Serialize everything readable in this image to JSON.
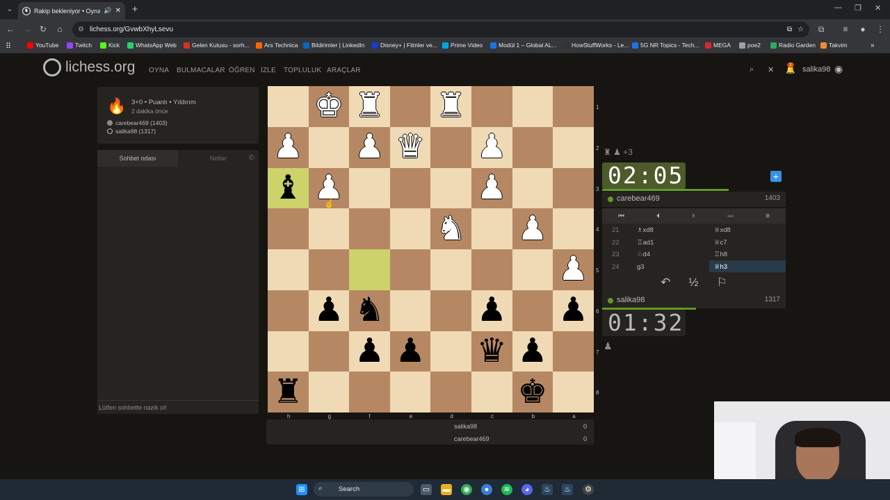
{
  "browser": {
    "tab_title": "Rakip bekleniyor • Oyna ca",
    "url": "lichess.org/GvwbXhyLsevu",
    "bookmarks": [
      "YouTube",
      "Twitch",
      "Kick",
      "WhatsApp Web",
      "Gelen Kutusu - sorh...",
      "Ars Technica",
      "Bildirimler | LinkedIn",
      "Disney+ | Filmler ve...",
      "Prime Video",
      "Modül 1 – Global AL...",
      "HowStuffWorks - Le...",
      "5G NR Topics - Tech...",
      "MEGA",
      "poe2",
      "Radio Garden",
      "Takvim"
    ],
    "bookmark_colors": [
      "#ff0000",
      "#9146ff",
      "#53fc18",
      "#25d366",
      "#d93025",
      "#ff6600",
      "#0a66c2",
      "#113ccf",
      "#00a8e1",
      "#1a73e8",
      "#333333",
      "#1a73e8",
      "#d9272e",
      "#9aa0a6",
      "#27ae60",
      "#f28b30"
    ]
  },
  "site": {
    "logo_text": "lichess.org",
    "menu": [
      "OYNA",
      "BULMACALAR",
      "ÖĞREN",
      "İZLE",
      "TOPLULUK",
      "ARAÇLAR"
    ],
    "username": "salika98",
    "notif_count": "1"
  },
  "game_info": {
    "mode": "3+0 • Puanlı • Yıldırım",
    "when": "2 dakika önce",
    "player_black": "carebear469 (1403)",
    "player_white": "salika98 (1317)"
  },
  "chat": {
    "tab_room": "Sohbet odası",
    "tab_notes": "Notlar",
    "placeholder": "Lütfen sohbette nazik ol!"
  },
  "board": {
    "ranks": [
      "1",
      "2",
      "3",
      "4",
      "5",
      "6",
      "7",
      "8"
    ],
    "files": [
      "h",
      "g",
      "f",
      "e",
      "d",
      "c",
      "b",
      "a"
    ],
    "rows": [
      [
        "",
        "wK",
        "wR",
        "",
        "wR",
        "",
        "",
        ""
      ],
      [
        "wP",
        "",
        "wP",
        "wQ",
        "",
        "wP",
        "",
        ""
      ],
      [
        "bB",
        "wP",
        "",
        "",
        "",
        "wP",
        "",
        ""
      ],
      [
        "",
        "",
        "",
        "",
        "wN",
        "",
        "wP",
        ""
      ],
      [
        "",
        "",
        "",
        "",
        "",
        "",
        "",
        "wP"
      ],
      [
        "",
        "bP",
        "bN",
        "",
        "",
        "bP",
        "",
        "bP"
      ],
      [
        "",
        "",
        "bP",
        "bP",
        "",
        "bQ",
        "bP",
        ""
      ],
      [
        "bR",
        "",
        "",
        "",
        "",
        "",
        "bK",
        ""
      ]
    ],
    "highlights": [
      [
        2,
        0
      ],
      [
        4,
        2
      ]
    ],
    "colors": {
      "light": "#f0d9b5",
      "dark": "#b58863",
      "highlight": "#cdd26a"
    }
  },
  "score": [
    {
      "name": "salika98",
      "value": "0"
    },
    {
      "name": "carebear469",
      "value": "0"
    }
  ],
  "opponent": {
    "captured": "♜ ♟ +3",
    "clock": "02:05",
    "clock_fraction": 0.69,
    "name": "carebear469",
    "rating": "1403"
  },
  "me": {
    "clock": "01:32",
    "clock_fraction": 0.51,
    "name": "salika98",
    "rating": "1317",
    "captured": "♟"
  },
  "moves": [
    {
      "num": "21",
      "white": "♗xd8",
      "black": "♕xd8"
    },
    {
      "num": "22",
      "white": "♖ad1",
      "black": "♕c7"
    },
    {
      "num": "23",
      "white": "♘d4",
      "black": "♖h8"
    },
    {
      "num": "24",
      "white": "g3",
      "black": "♕h3"
    }
  ],
  "selected_move": "24b",
  "taskbar": {
    "search": "Search"
  }
}
